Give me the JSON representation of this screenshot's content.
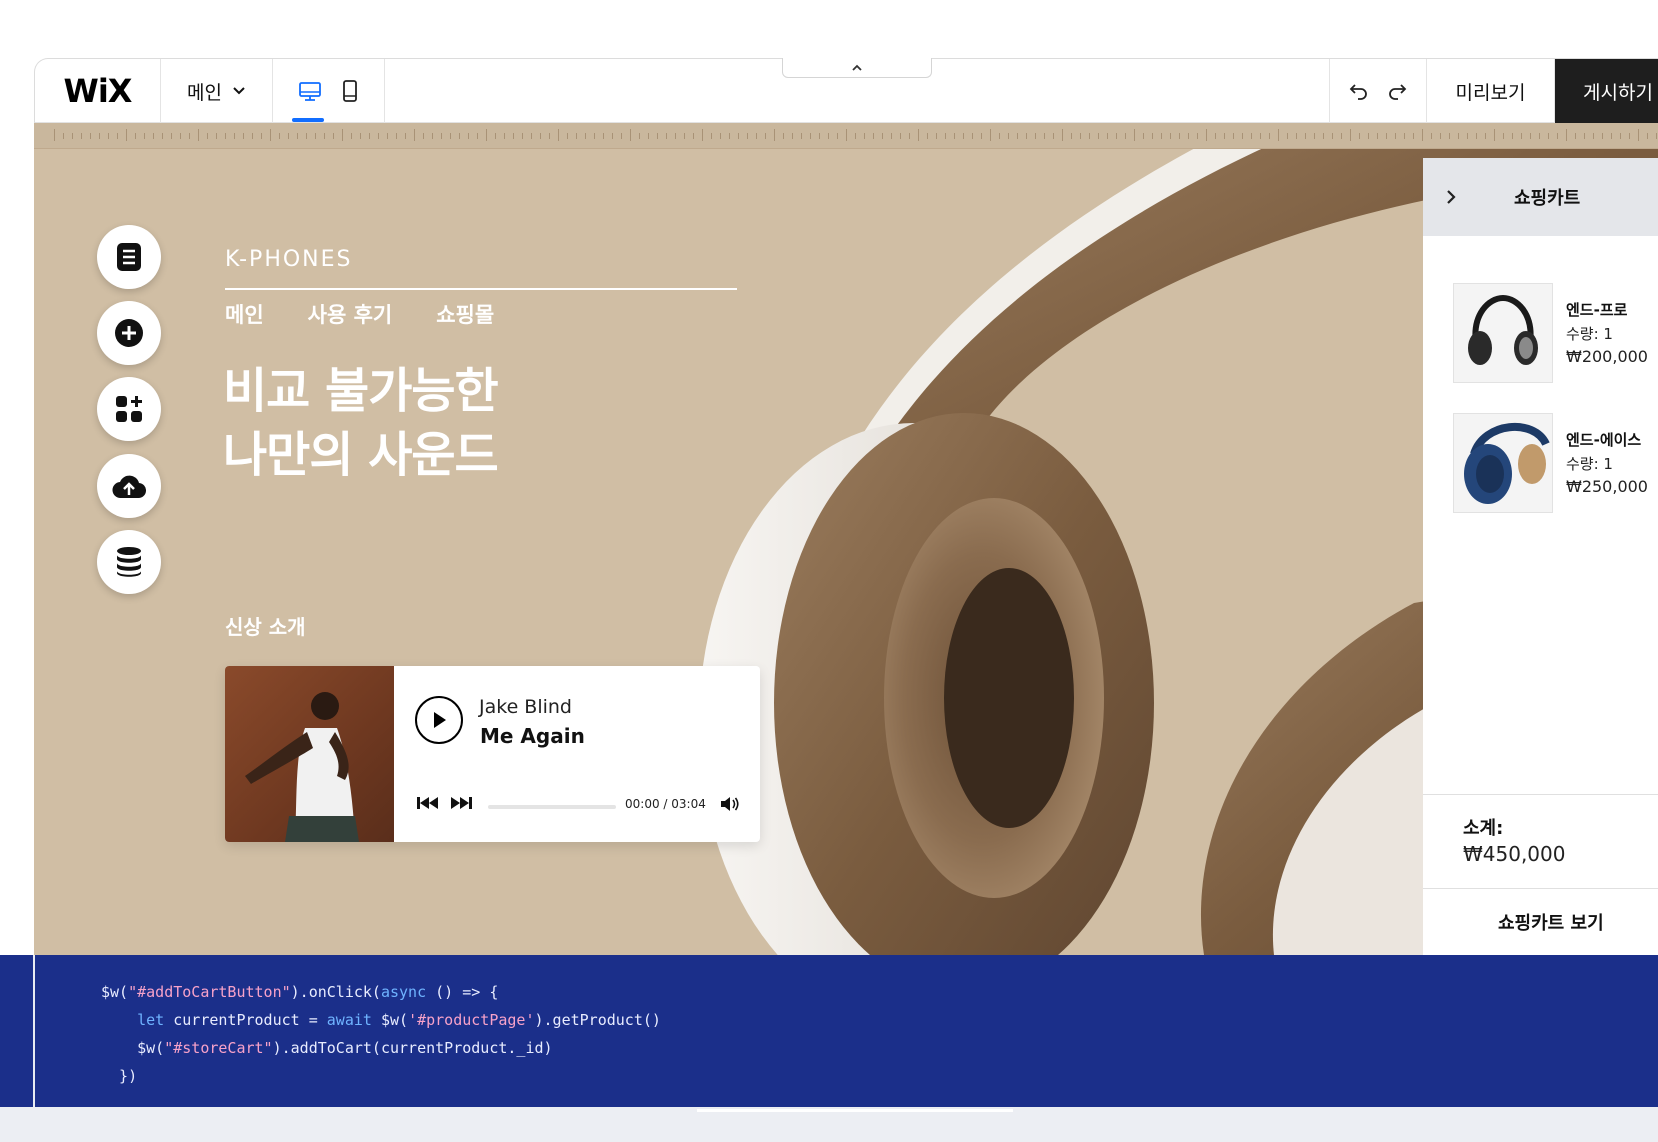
{
  "editor": {
    "logo": "WiX",
    "page_selector": "메인",
    "preview": "미리보기",
    "publish": "게시하기"
  },
  "site": {
    "brand": "K-PHONES",
    "nav": [
      "메인",
      "사용 후기",
      "쇼핑몰"
    ],
    "hero_line1": "비교 불가능한",
    "hero_line2": "나만의 사운드",
    "new_label": "신상 소개"
  },
  "player": {
    "artist": "Jake Blind",
    "track": "Me Again",
    "time": "00:00 / 03:04",
    "progress": 0
  },
  "cart": {
    "title": "쇼핑카트",
    "items": [
      {
        "name": "엔드-프로",
        "qty": "수량: 1",
        "price": "₩200,000"
      },
      {
        "name": "엔드-에이스",
        "qty": "수량: 1",
        "price": "₩250,000"
      }
    ],
    "subtotal_label": "소계:",
    "subtotal_value": "₩450,000",
    "view_cart": "쇼핑카트 보기"
  },
  "code": {
    "line1": [
      "$w(",
      "\"#addToCartButton\"",
      ").onClick(",
      "async",
      " () => {"
    ],
    "line2": [
      "    ",
      "let",
      " currentProduct = ",
      "await",
      " $w(",
      "'#productPage'",
      ").getProduct()"
    ],
    "line3": [
      "    $w(",
      "\"#storeCart\"",
      ").addToCart(currentProduct._id)"
    ],
    "line4": "  })"
  },
  "colors": {
    "canvas_bg": "#d0bea4",
    "accent": "#116dff",
    "code_bg": "#1b2f8a",
    "publish_bg": "#1e1e1e"
  }
}
